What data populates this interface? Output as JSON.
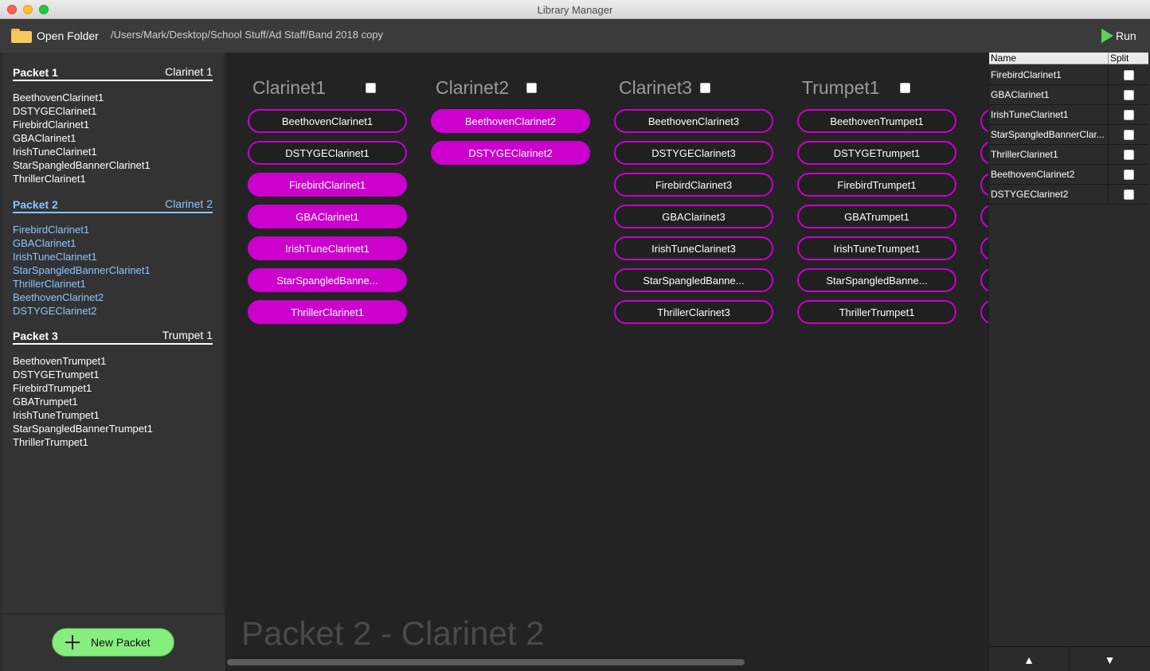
{
  "window": {
    "title": "Library Manager"
  },
  "toolbar": {
    "open_folder_label": "Open Folder",
    "folder_path": "/Users/Mark/Desktop/School Stuff/Ad Staff/Band 2018 copy",
    "run_label": "Run"
  },
  "sidebar": {
    "packets": [
      {
        "name": "Packet 1",
        "instrument": "Clarinet 1",
        "active": false,
        "items": [
          "BeethovenClarinet1",
          "DSTYGEClarinet1",
          "FirebirdClarinet1",
          "GBAClarinet1",
          "IrishTuneClarinet1",
          "StarSpangledBannerClarinet1",
          "ThrillerClarinet1"
        ]
      },
      {
        "name": "Packet 2",
        "instrument": "Clarinet 2",
        "active": true,
        "items": [
          "FirebirdClarinet1",
          "GBAClarinet1",
          "IrishTuneClarinet1",
          "StarSpangledBannerClarinet1",
          "ThrillerClarinet1",
          "BeethovenClarinet2",
          "DSTYGEClarinet2"
        ]
      },
      {
        "name": "Packet 3",
        "instrument": "Trumpet 1",
        "active": false,
        "items": [
          "BeethovenTrumpet1",
          "DSTYGETrumpet1",
          "FirebirdTrumpet1",
          "GBATrumpet1",
          "IrishTuneTrumpet1",
          "StarSpangledBannerTrumpet1",
          "ThrillerTrumpet1"
        ]
      }
    ],
    "new_packet_label": "New Packet"
  },
  "main": {
    "watermark": "Packet 2 - Clarinet 2",
    "columns": [
      {
        "heading": "Clarinet1",
        "checked": false,
        "items": [
          {
            "label": "BeethovenClarinet1",
            "selected": false
          },
          {
            "label": "DSTYGEClarinet1",
            "selected": false
          },
          {
            "label": "FirebirdClarinet1",
            "selected": true
          },
          {
            "label": "GBAClarinet1",
            "selected": true
          },
          {
            "label": "IrishTuneClarinet1",
            "selected": true
          },
          {
            "label": "StarSpangledBanne...",
            "selected": true
          },
          {
            "label": "ThrillerClarinet1",
            "selected": true
          }
        ]
      },
      {
        "heading": "Clarinet2",
        "checked": false,
        "items": [
          {
            "label": "BeethovenClarinet2",
            "selected": true
          },
          {
            "label": "DSTYGEClarinet2",
            "selected": true
          }
        ]
      },
      {
        "heading": "Clarinet3",
        "checked": false,
        "items": [
          {
            "label": "BeethovenClarinet3",
            "selected": false
          },
          {
            "label": "DSTYGEClarinet3",
            "selected": false
          },
          {
            "label": "FirebirdClarinet3",
            "selected": false
          },
          {
            "label": "GBAClarinet3",
            "selected": false
          },
          {
            "label": "IrishTuneClarinet3",
            "selected": false
          },
          {
            "label": "StarSpangledBanne...",
            "selected": false
          },
          {
            "label": "ThrillerClarinet3",
            "selected": false
          }
        ]
      },
      {
        "heading": "Trumpet1",
        "checked": false,
        "items": [
          {
            "label": "BeethovenTrumpet1",
            "selected": false
          },
          {
            "label": "DSTYGETrumpet1",
            "selected": false
          },
          {
            "label": "FirebirdTrumpet1",
            "selected": false
          },
          {
            "label": "GBATrumpet1",
            "selected": false
          },
          {
            "label": "IrishTuneTrumpet1",
            "selected": false
          },
          {
            "label": "StarSpangledBanne...",
            "selected": false
          },
          {
            "label": "ThrillerTrumpet1",
            "selected": false
          }
        ]
      }
    ]
  },
  "split_table": {
    "headers": {
      "name": "Name",
      "split": "Split"
    },
    "rows": [
      {
        "name": "FirebirdClarinet1",
        "split": false
      },
      {
        "name": "GBAClarinet1",
        "split": false
      },
      {
        "name": "IrishTuneClarinet1",
        "split": false
      },
      {
        "name": "StarSpangledBannerClar...",
        "split": false
      },
      {
        "name": "ThrillerClarinet1",
        "split": false
      },
      {
        "name": "BeethovenClarinet2",
        "split": false
      },
      {
        "name": "DSTYGEClarinet2",
        "split": false
      }
    ],
    "up_label": "▲",
    "down_label": "▼"
  },
  "colors": {
    "accent": "#cc00cc",
    "active_packet": "#8ec5ff",
    "new_packet": "#86ee7e",
    "run_icon": "#5ad35a"
  }
}
